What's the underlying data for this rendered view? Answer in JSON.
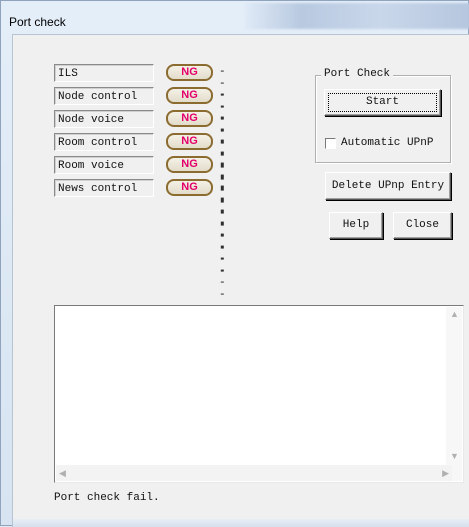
{
  "window": {
    "title": "Port check"
  },
  "ports": [
    {
      "name": "ILS",
      "status": "NG",
      "result": "----------"
    },
    {
      "name": "Node control",
      "status": "NG",
      "result": "----------"
    },
    {
      "name": "Node voice",
      "status": "NG",
      "result": "----------"
    },
    {
      "name": "Room control",
      "status": "NG",
      "result": "----------"
    },
    {
      "name": "Room voice",
      "status": "NG",
      "result": "----------"
    },
    {
      "name": "News control",
      "status": "NG",
      "result": "----------"
    }
  ],
  "port_check_group": {
    "legend": "Port Check",
    "start_label": "Start",
    "automatic_upnp_label": "Automatic UPnP",
    "automatic_upnp_checked": false
  },
  "buttons": {
    "delete_upnp_label": "Delete UPnp Entry",
    "help_label": "Help",
    "close_label": "Close"
  },
  "log": {
    "content": ""
  },
  "status": {
    "message": "Port check fail."
  },
  "colors": {
    "ng_text": "#e4006a",
    "ng_border": "#8b6b30"
  }
}
